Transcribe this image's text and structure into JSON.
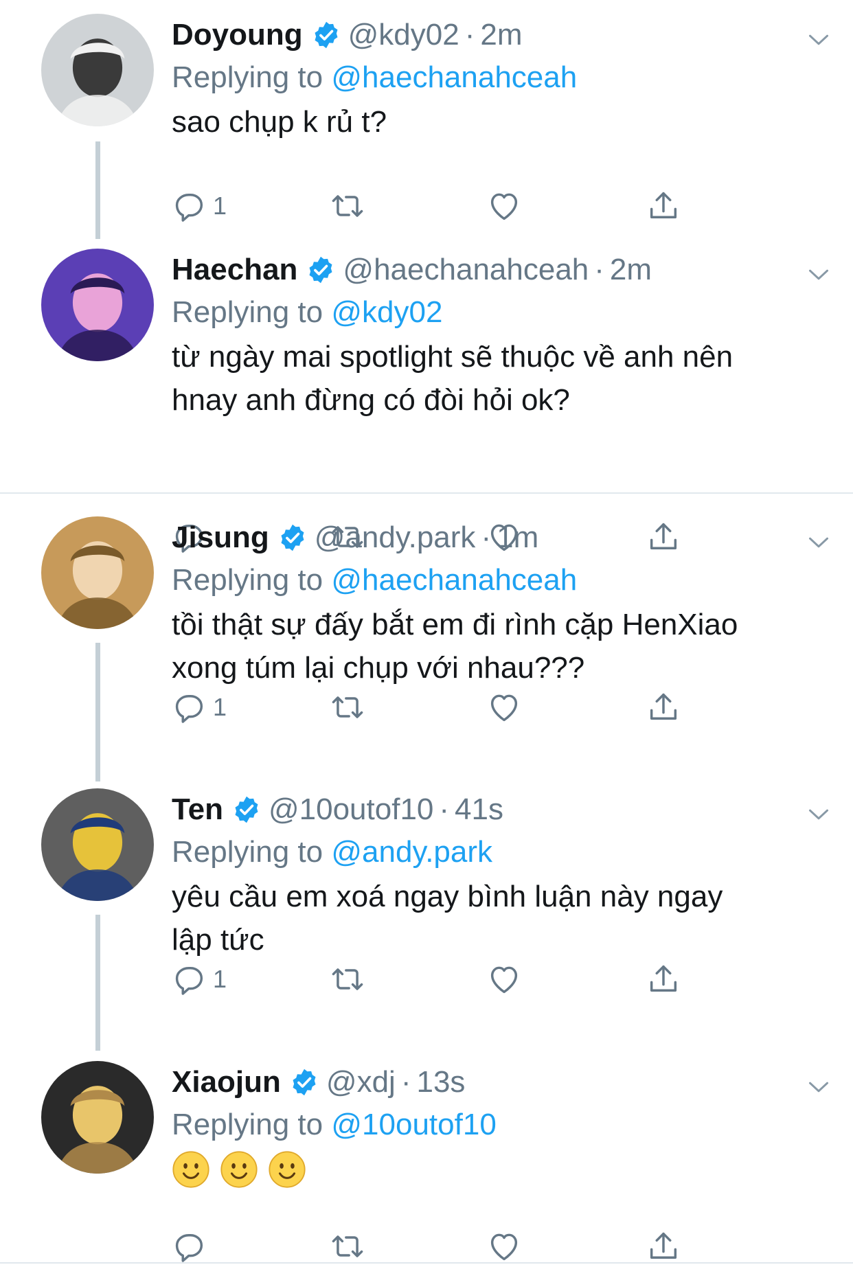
{
  "tweets": [
    {
      "name": "Doyoung",
      "handle": "@kdy02",
      "time": "2m",
      "replying_prefix": "Replying to",
      "replying_to": "@haechanahceah",
      "text_lines": [
        "sao chụp k rủ t?"
      ],
      "reply_count": "1",
      "avatar_colors": [
        "#cfd3d6",
        "#3a3a3a",
        "#f1f1f1"
      ]
    },
    {
      "name": "Haechan",
      "handle": "@haechanahceah",
      "time": "2m",
      "replying_prefix": "Replying to",
      "replying_to": "@kdy02",
      "text_lines": [
        "từ ngày mai spotlight sẽ thuộc về anh nên",
        "hnay anh đừng có đòi hỏi ok?"
      ],
      "reply_count": "",
      "avatar_colors": [
        "#5b3fb5",
        "#e9a3d8",
        "#2a1a55"
      ]
    },
    {
      "name": "Jisung",
      "handle": "@andy.park",
      "time": "1m",
      "replying_prefix": "Replying to",
      "replying_to": "@haechanahceah",
      "text_lines": [
        "tồi thật sự đấy bắt em đi rình cặp HenXiao",
        "xong túm lại chụp với nhau???"
      ],
      "reply_count": "1",
      "avatar_colors": [
        "#c79a5a",
        "#f0d5b0",
        "#7a5a2a"
      ]
    },
    {
      "name": "Ten",
      "handle": "@10outof10",
      "time": "41s",
      "replying_prefix": "Replying to",
      "replying_to": "@andy.park",
      "text_lines": [
        "yêu cầu em xoá ngay bình luận này ngay",
        "lập tức"
      ],
      "reply_count": "1",
      "avatar_colors": [
        "#5f5f5f",
        "#e6c23a",
        "#1f3b7a"
      ]
    },
    {
      "name": "Xiaojun",
      "handle": "@xdj",
      "time": "13s",
      "replying_prefix": "Replying to",
      "replying_to": "@10outof10",
      "text_lines": [],
      "emoji_count": 3,
      "reply_count": "",
      "avatar_colors": [
        "#2a2a2a",
        "#e8c56a",
        "#b08a4a"
      ]
    }
  ],
  "icons": {
    "verified": "verified-badge-icon",
    "caret": "chevron-down-icon",
    "reply": "reply-icon",
    "retweet": "retweet-icon",
    "like": "heart-icon",
    "share": "share-icon",
    "emoji": "slightly-smiling-face-icon"
  },
  "colors": {
    "link_blue": "#1da1f2",
    "verified_blue": "#1da1f2",
    "secondary_gray": "#657786",
    "thread_line": "#c4cfd6",
    "icon_gray": "#657786"
  }
}
